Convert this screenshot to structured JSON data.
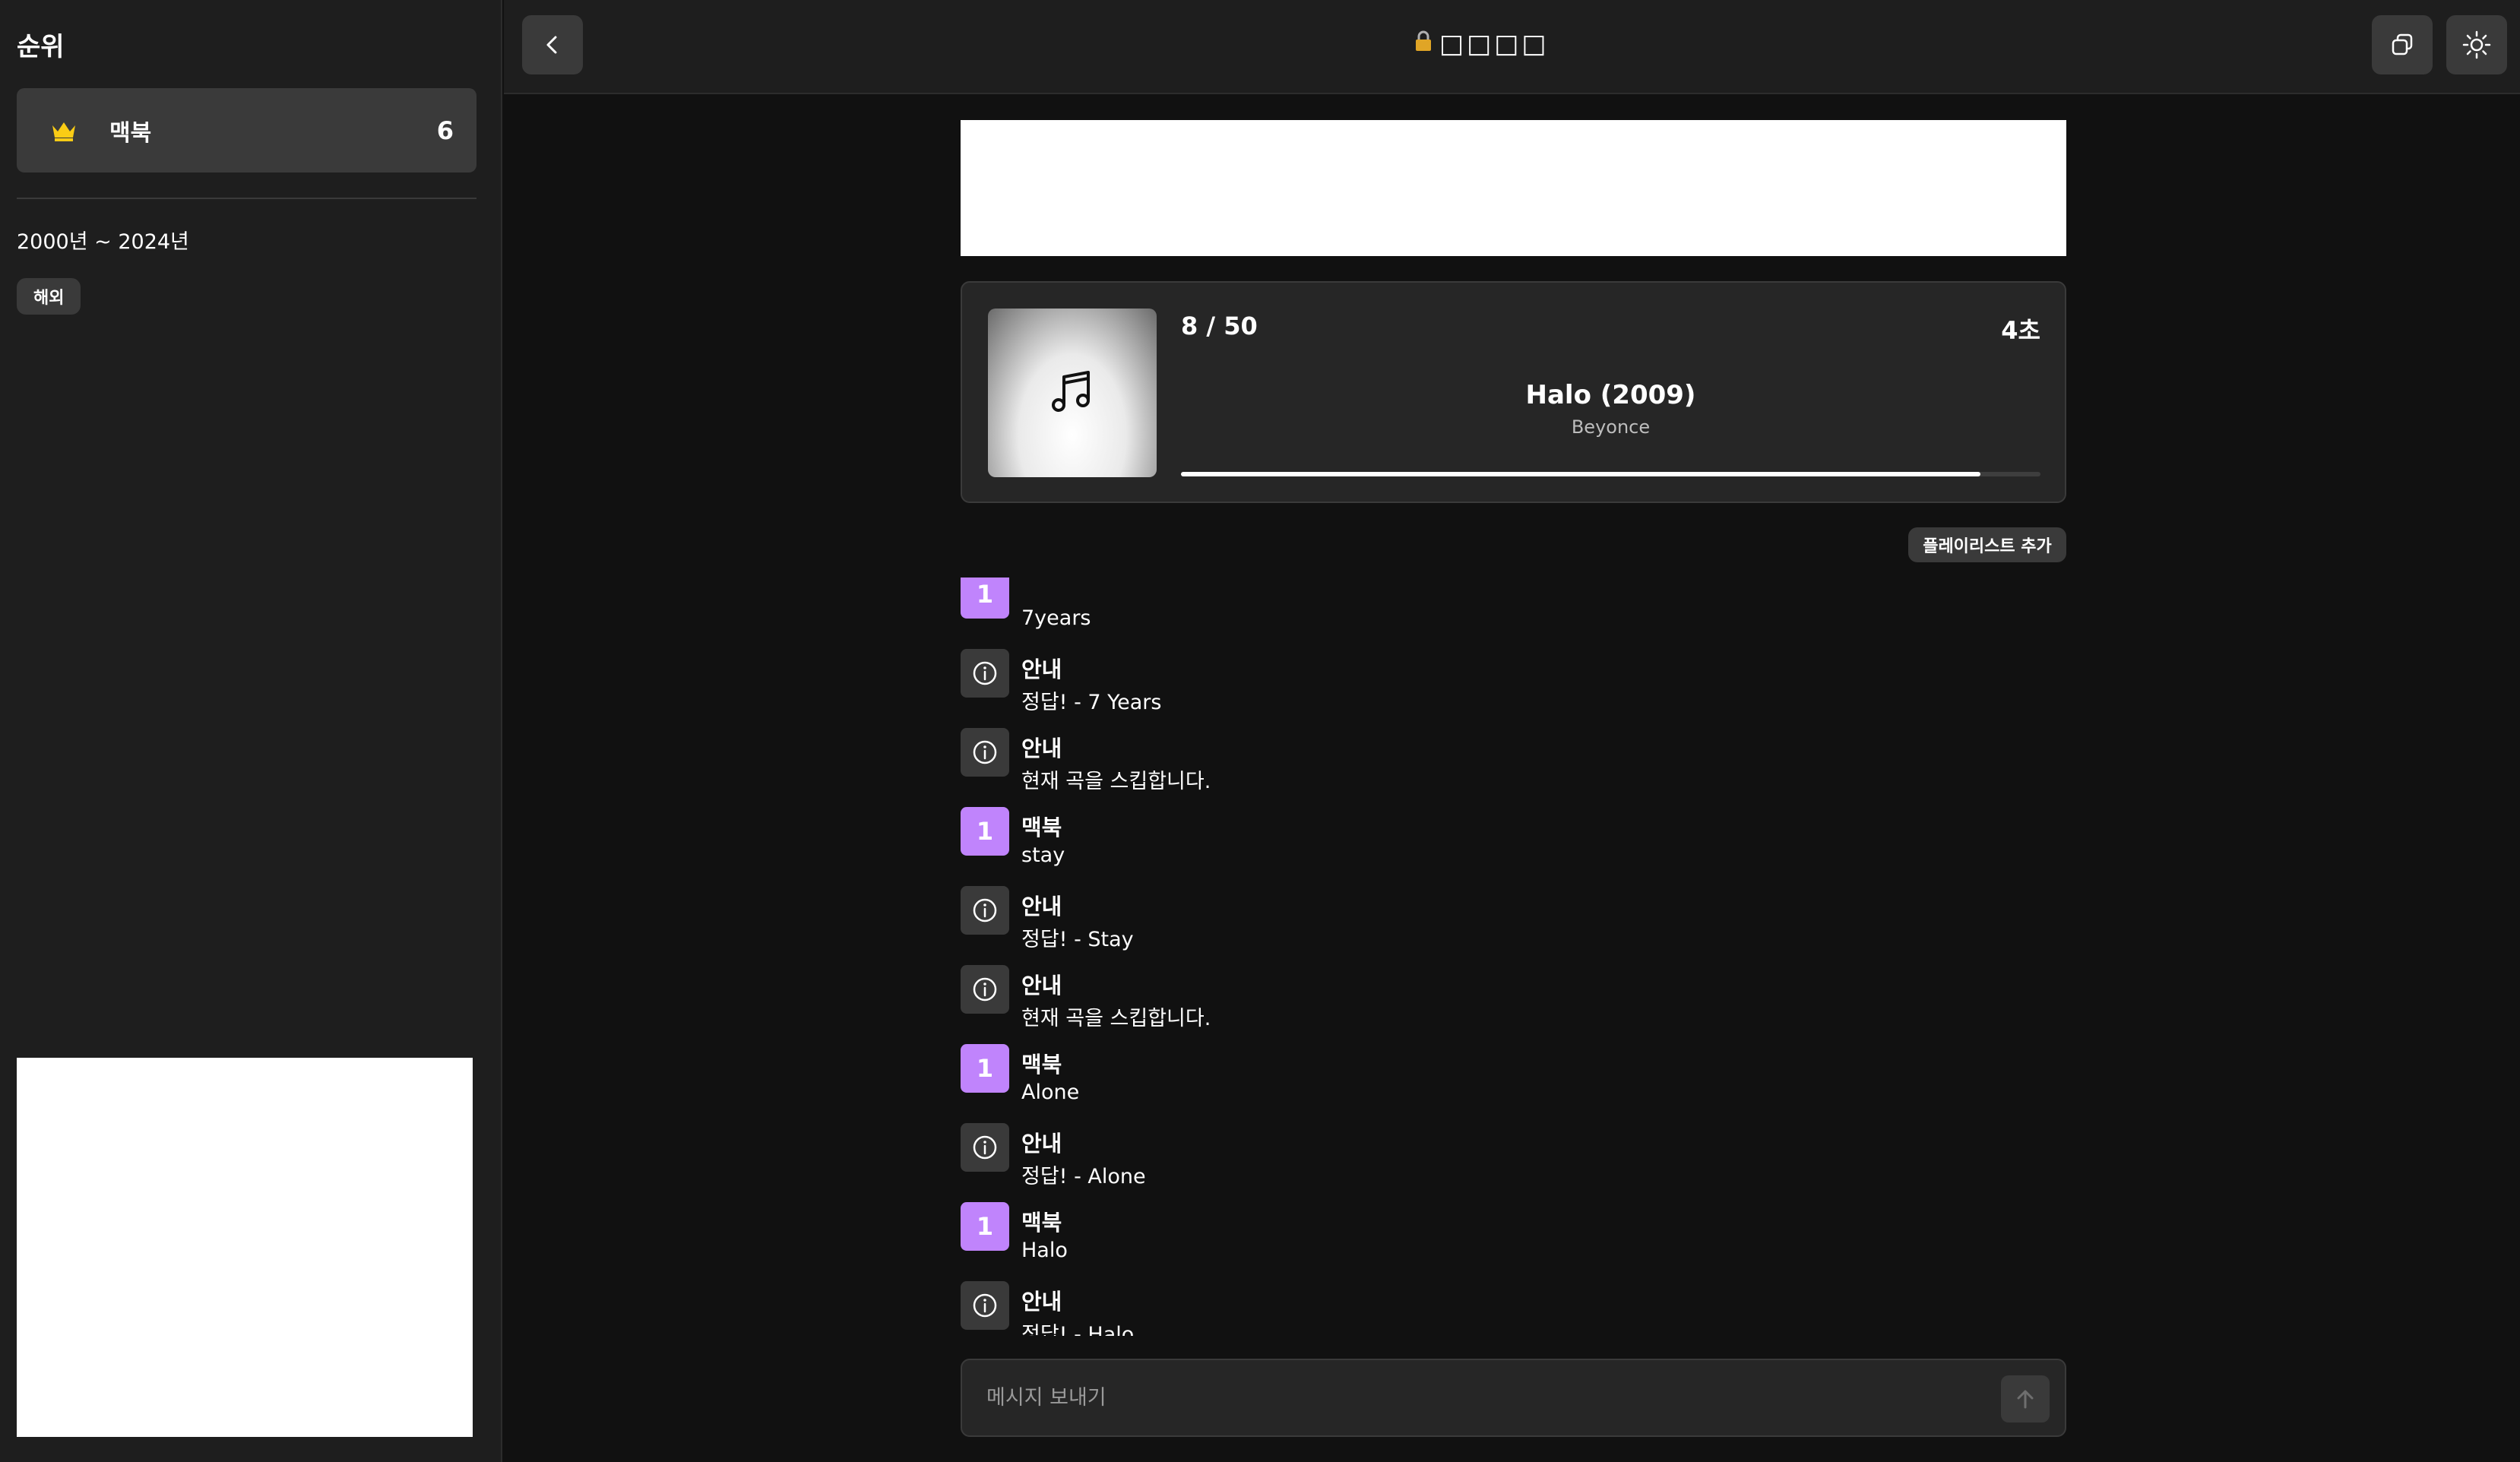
{
  "sidebar": {
    "title": "순위",
    "ranking": [
      {
        "name": "맥북",
        "score": "6",
        "icon": "crown-icon"
      }
    ],
    "year_range": "2000년 ~ 2024년",
    "region": "해외"
  },
  "header": {
    "room_title": "□□□□",
    "lock_icon": "lock-icon"
  },
  "player": {
    "counter": "8 / 50",
    "timer": "4초",
    "song_title": "Halo (2009)",
    "artist": "Beyonce",
    "progress": 0.93
  },
  "playlist_button": "플레이리스트 추가",
  "chat": {
    "messages": [
      {
        "type": "user",
        "badge": "1",
        "name": "",
        "text": "7years"
      },
      {
        "type": "system",
        "name": "안내",
        "text": "정답! - 7 Years"
      },
      {
        "type": "system",
        "name": "안내",
        "text": "현재 곡을 스킵합니다."
      },
      {
        "type": "user",
        "badge": "1",
        "name": "맥북",
        "text": "stay"
      },
      {
        "type": "system",
        "name": "안내",
        "text": "정답! - Stay"
      },
      {
        "type": "system",
        "name": "안내",
        "text": "현재 곡을 스킵합니다."
      },
      {
        "type": "user",
        "badge": "1",
        "name": "맥북",
        "text": "Alone"
      },
      {
        "type": "system",
        "name": "안내",
        "text": "정답! - Alone"
      },
      {
        "type": "user",
        "badge": "1",
        "name": "맥북",
        "text": "Halo"
      },
      {
        "type": "system",
        "name": "안내",
        "text": "정답! - Halo"
      }
    ]
  },
  "input": {
    "placeholder": "메시지 보내기"
  },
  "colors": {
    "background": "#111111",
    "panel": "#1e1e1e",
    "card": "#262626",
    "button": "#3a3a3a",
    "user_badge": "#c084fc",
    "crown": "#facc15"
  }
}
